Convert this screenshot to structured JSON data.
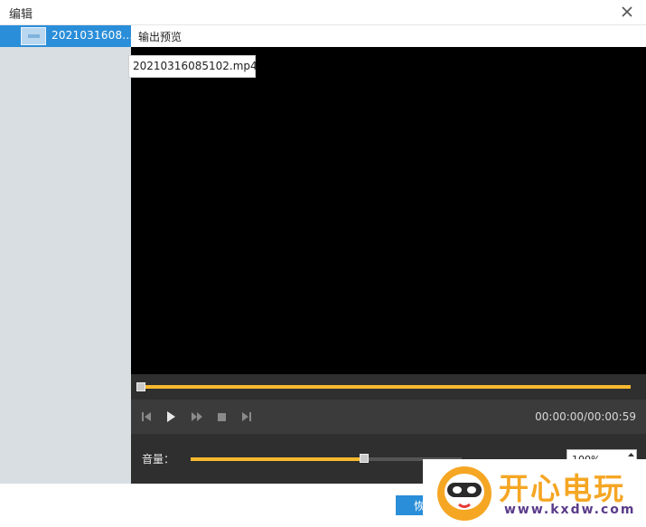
{
  "window": {
    "title": "编辑",
    "close_icon": "close-icon"
  },
  "sidebar": {
    "items": [
      {
        "label": "2021031608...",
        "selected": true,
        "thumbnail": "video-thumbnail"
      }
    ]
  },
  "preview": {
    "tab_label": "输出预览",
    "tooltip": "20210316085102.mp4",
    "progress": 1.0
  },
  "controls": {
    "icons": [
      "skip-previous-icon",
      "play-icon",
      "fast-forward-icon",
      "stop-icon",
      "skip-next-icon"
    ],
    "timecode": "00:00:00/00:00:59"
  },
  "volume": {
    "label": "音量：",
    "level": 0.64,
    "value": "100%"
  },
  "footer": {
    "restore_label": "恢"
  },
  "watermark": {
    "brand": "开心电玩",
    "url": "www.kxdw.com"
  },
  "colors": {
    "accent": "#2b8ed8",
    "progress": "#f5b82e",
    "player_bg": "#2f2f2f",
    "sidebar_bg": "#d9dee3"
  }
}
